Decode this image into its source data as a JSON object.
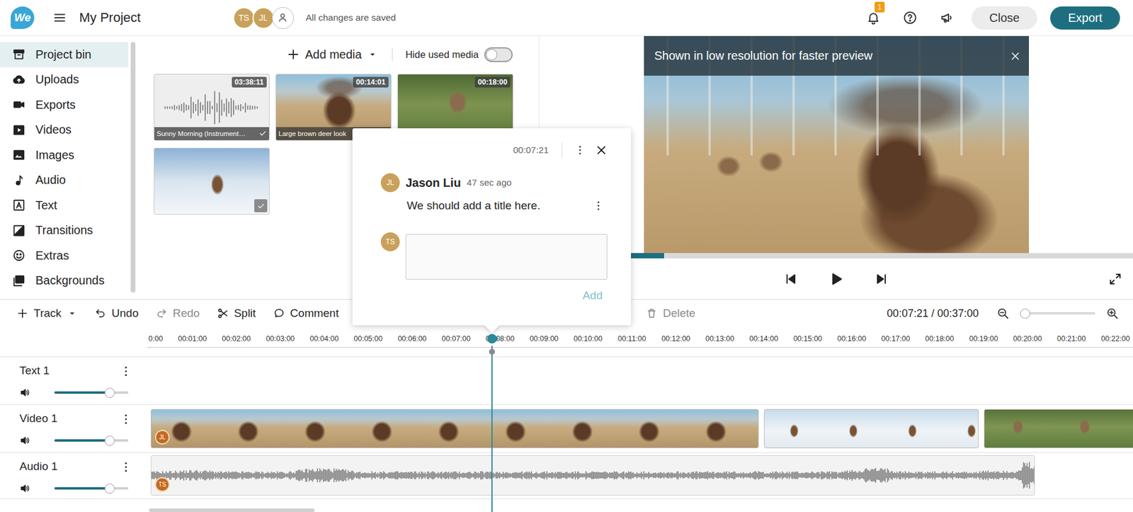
{
  "topbar": {
    "logo": "We",
    "title": "My Project",
    "collaborators": [
      {
        "initials": "TS"
      },
      {
        "initials": "JL"
      }
    ],
    "status": "All changes are saved",
    "notifications": "1",
    "buttons": [
      {
        "label": "Close",
        "kind": "secondary"
      },
      {
        "label": "Export",
        "kind": "primary"
      }
    ]
  },
  "sidebar": {
    "items": [
      {
        "label": "Project bin",
        "selected": true
      },
      {
        "label": "Uploads",
        "selected": false
      },
      {
        "label": "Exports",
        "selected": false
      },
      {
        "label": "Videos",
        "selected": false
      },
      {
        "label": "Images",
        "selected": false
      },
      {
        "label": "Audio",
        "selected": false
      },
      {
        "label": "Text",
        "selected": false
      },
      {
        "label": "Transitions",
        "selected": false
      },
      {
        "label": "Extras",
        "selected": false
      },
      {
        "label": "Backgrounds",
        "selected": false
      }
    ]
  },
  "media": {
    "add_label": "Add media",
    "hide_used": {
      "label": "Hide used media",
      "on": false
    },
    "items": [
      {
        "kind": "audio",
        "duration": "03:38:11",
        "caption": "Sunny Morning (Instrument…",
        "used": true
      },
      {
        "kind": "video",
        "duration": "00:14:01",
        "caption": "Large brown deer look",
        "used": true
      },
      {
        "kind": "video",
        "duration": "00:18:00",
        "used": false
      },
      {
        "kind": "image",
        "used": true
      }
    ]
  },
  "preview": {
    "banner": "Shown in low resolution for faster preview",
    "progress": {
      "level": 0.21
    }
  },
  "toolbar": {
    "items": [
      {
        "label": "Track",
        "disabled": false,
        "dropdown": true
      },
      {
        "label": "Undo",
        "disabled": false,
        "dropdown": false
      },
      {
        "label": "Redo",
        "disabled": true,
        "dropdown": false
      },
      {
        "label": "Split",
        "disabled": false,
        "dropdown": false
      },
      {
        "label": "Comment",
        "disabled": false,
        "dropdown": false
      },
      {
        "label": "Delete",
        "disabled": true,
        "dropdown": false
      }
    ],
    "time": "00:07:21 / 00:37:00",
    "zoom": {
      "level": 0
    }
  },
  "timeline": {
    "ruler": [
      "0:00",
      "00:01:00",
      "00:02:00",
      "00:03:00",
      "00:04:00",
      "00:05:00",
      "00:06:00",
      "00:07:00",
      "00:08:00",
      "00:09:00",
      "00:10:00",
      "00:11:00",
      "00:12:00",
      "00:13:00",
      "00:14:00",
      "00:15:00",
      "00:16:00",
      "00:17:00",
      "00:18:00",
      "00:19:00",
      "00:20:00",
      "00:21:00",
      "00:22:00"
    ],
    "tracks": [
      {
        "name": "Text 1",
        "kind": "text",
        "volume": 0.74,
        "clips": []
      },
      {
        "name": "Video 1",
        "kind": "video",
        "volume": 0.74,
        "clips": [
          {
            "author": "JL"
          },
          {},
          {}
        ]
      },
      {
        "name": "Audio 1",
        "kind": "audio",
        "volume": 0.74,
        "clips": [
          {
            "author": "TS"
          }
        ]
      }
    ]
  },
  "comment": {
    "time": "00:07:21",
    "thread": [
      {
        "initials": "JL",
        "author": "Jason Liu",
        "ago": "47 sec ago",
        "text": "We should add a title here."
      }
    ],
    "reply": {
      "initials": "TS"
    },
    "submit": {
      "label": "Add",
      "disabled": true
    }
  }
}
